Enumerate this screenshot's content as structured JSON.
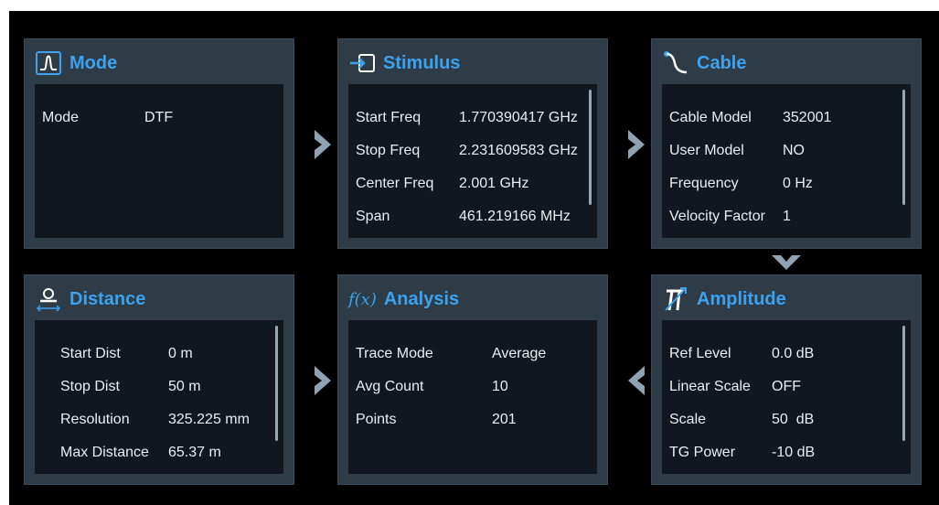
{
  "panels": {
    "mode": {
      "title": "Mode",
      "rows": [
        {
          "label": "Mode",
          "value": "DTF"
        }
      ]
    },
    "stimulus": {
      "title": "Stimulus",
      "rows": [
        {
          "label": "Start Freq",
          "value": "1.770390417 GHz"
        },
        {
          "label": "Stop Freq",
          "value": "2.231609583 GHz"
        },
        {
          "label": "Center Freq",
          "value": "2.001 GHz"
        },
        {
          "label": "Span",
          "value": "461.219166 MHz"
        }
      ]
    },
    "cable": {
      "title": "Cable",
      "rows": [
        {
          "label": "Cable Model",
          "value": "352001"
        },
        {
          "label": "User Model",
          "value": "NO"
        },
        {
          "label": "Frequency",
          "value": "0 Hz"
        },
        {
          "label": "Velocity Factor",
          "value": "1"
        }
      ]
    },
    "distance": {
      "title": "Distance",
      "rows": [
        {
          "label": "Start Dist",
          "value": "0 m"
        },
        {
          "label": "Stop Dist",
          "value": "50 m"
        },
        {
          "label": "Resolution",
          "value": "325.225 mm"
        },
        {
          "label": "Max Distance",
          "value": "65.37 m"
        }
      ]
    },
    "analysis": {
      "title": "Analysis",
      "icon_text": "f(x)",
      "rows": [
        {
          "label": "Trace Mode",
          "value": "Average"
        },
        {
          "label": "Avg Count",
          "value": "10"
        },
        {
          "label": "Points",
          "value": "201"
        }
      ]
    },
    "amplitude": {
      "title": "Amplitude",
      "rows": [
        {
          "label": "Ref Level",
          "value": "0.0 dB"
        },
        {
          "label": "Linear Scale",
          "value": "OFF"
        },
        {
          "label": "Scale",
          "value": "50  dB"
        },
        {
          "label": "TG Power",
          "value": "-10 dB"
        }
      ]
    }
  },
  "icons": {
    "mode": "pulse-icon",
    "stimulus": "input-arrow-icon",
    "cable": "cable-icon",
    "distance": "distance-icon",
    "analysis": "function-icon",
    "amplitude": "amplitude-icon",
    "flow_arrows": [
      "chevron-right-icon",
      "chevron-right-icon",
      "chevron-down-icon",
      "chevron-left-icon",
      "chevron-right-icon"
    ]
  },
  "colors": {
    "accent": "#3da2ee",
    "panel": "#2e3c48",
    "panel_body": "#10171e",
    "arrow": "#8fa2b2"
  }
}
